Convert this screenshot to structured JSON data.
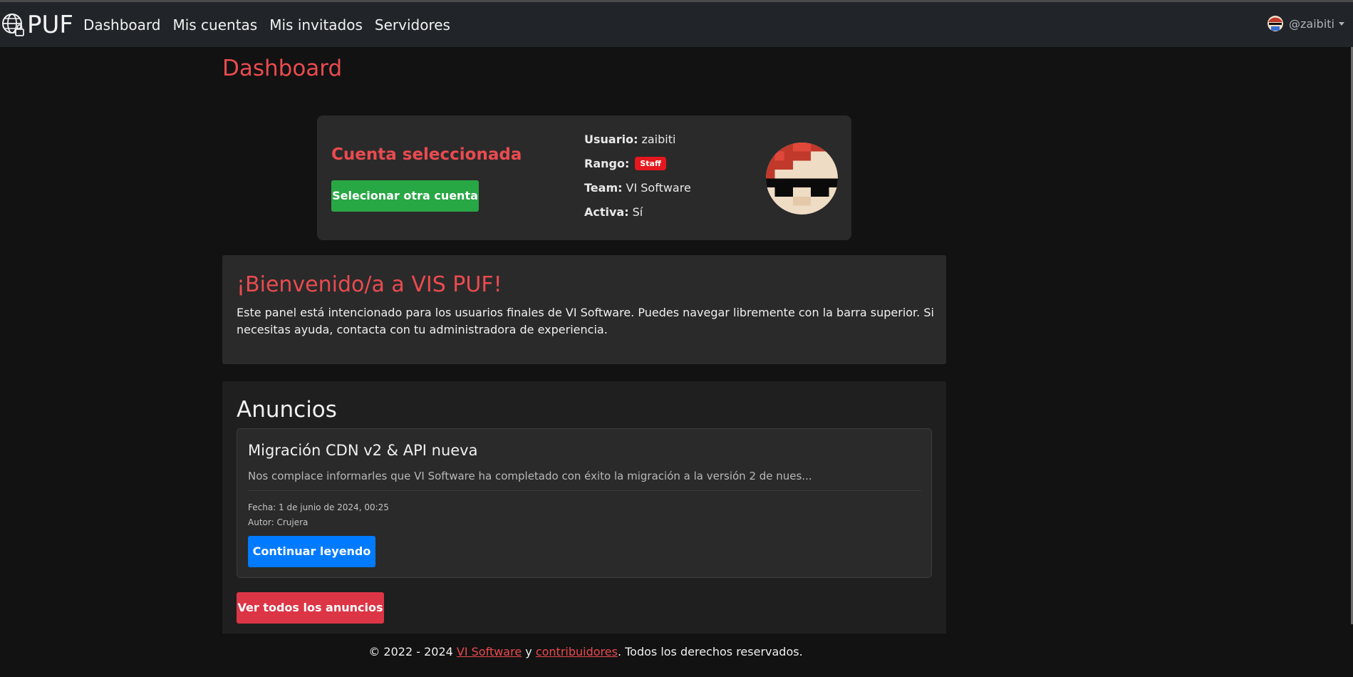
{
  "brand": {
    "name": "PUF"
  },
  "nav": {
    "links": [
      "Dashboard",
      "Mis cuentas",
      "Mis invitados",
      "Servidores"
    ],
    "user": "@zaibiti"
  },
  "page": {
    "title": "Dashboard"
  },
  "account": {
    "heading": "Cuenta seleccionada",
    "select_button": "Selecionar otra cuenta",
    "user_label": "Usuario:",
    "user_value": "zaibiti",
    "rank_label": "Rango:",
    "rank_badge": "Staff",
    "team_label": "Team:",
    "team_value": "VI Software",
    "active_label": "Activa:",
    "active_value": "Sí"
  },
  "welcome": {
    "title": "¡Bienvenido/a a VIS PUF!",
    "text": "Este panel está intencionado para los usuarios finales de VI Software. Puedes navegar libremente con la barra superior. Si necesitas ayuda, contacta con tu administradora de experiencia."
  },
  "announcements": {
    "title": "Anuncios",
    "items": [
      {
        "title": "Migración CDN v2 & API nueva",
        "excerpt": "Nos complace informarles que VI Software ha completado con éxito la migración a la versión 2 de nues...",
        "date": "Fecha: 1 de junio de 2024, 00:25",
        "author": "Autor: Crujera",
        "button": "Continuar leyendo"
      }
    ],
    "all_button": "Ver todos los anuncios"
  },
  "footer": {
    "prefix": "© 2022 - 2024 ",
    "link1": "VI Software",
    "middle": " y ",
    "link2": "contribuidores",
    "suffix": ". Todos los derechos reservados."
  },
  "colors": {
    "accent": "#ea4b4f",
    "navbar": "#212529",
    "success": "#28a745",
    "primary": "#007bff",
    "danger": "#dc3545",
    "badge": "#e4181e"
  }
}
